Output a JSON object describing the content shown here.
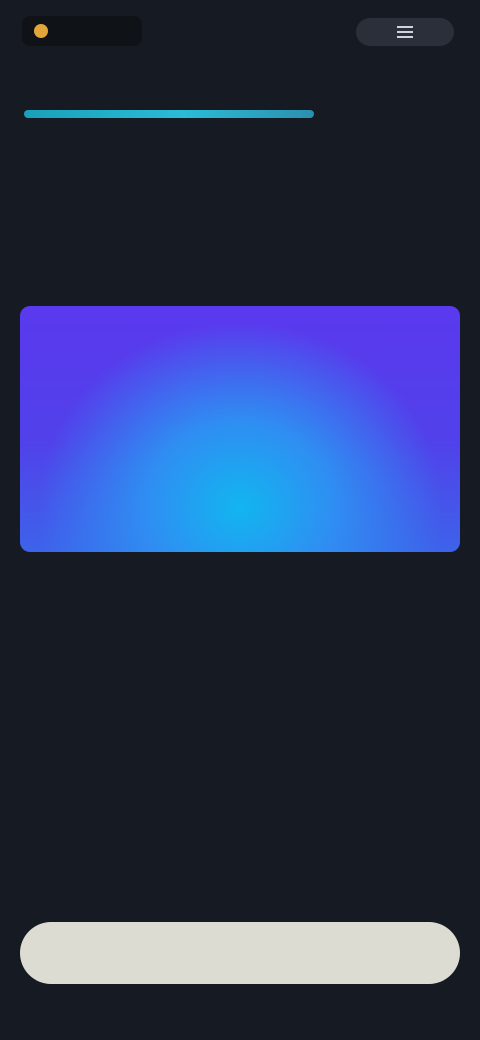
{
  "header": {
    "logo_text": "",
    "menu_icon": "menu-icon"
  },
  "article": {
    "title": "",
    "body": {
      "line1": "",
      "line2_text": "",
      "line2_link": "",
      "line3_link": ""
    }
  },
  "card": {
    "heading": "",
    "lines": [
      "",
      "",
      "",
      ""
    ]
  },
  "footnote": {
    "text": ""
  },
  "cta": {
    "label": ""
  },
  "colors": {
    "background": "#161a22",
    "accent_underline": "#2bbcd6",
    "card_top": "#5a39ee",
    "card_glow": "#12b5f0",
    "cta_background": "#dcdcd2"
  }
}
